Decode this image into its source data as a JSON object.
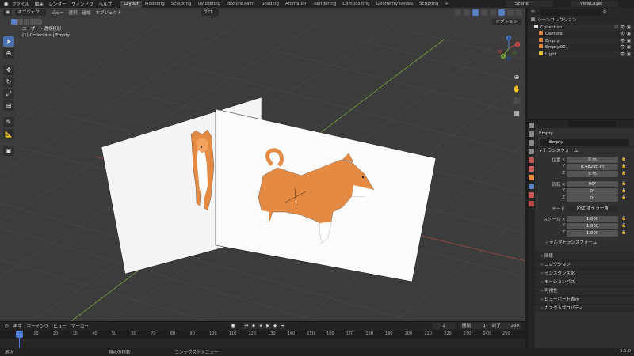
{
  "topbar": {
    "menu": [
      "ファイル",
      "編集",
      "レンダー",
      "ウィンドウ",
      "ヘルプ"
    ],
    "workspaces": [
      "Layout",
      "Modeling",
      "Sculpting",
      "UV Editing",
      "Texture Paint",
      "Shading",
      "Animation",
      "Rendering",
      "Compositing",
      "Geometry Nodes",
      "Scripting"
    ],
    "active_workspace": "Layout",
    "add_tab": "+",
    "scene": "Scene",
    "view_layer": "ViewLayer"
  },
  "viewport": {
    "mode": "オブジェク...",
    "menus": [
      "ビュー",
      "選択",
      "追加",
      "オブジェクト"
    ],
    "transform_orientation": "グロ...",
    "view_name": "ユーザー・透視投影",
    "view_context": "(1) Collection | Empty",
    "options_label": "オプション"
  },
  "gizmo": {
    "x": "X",
    "y": "Y",
    "z": "Z"
  },
  "timeline": {
    "menus": [
      "再生",
      "キーイング",
      "ビュー",
      "マーカー"
    ],
    "current_frame": "1",
    "start_label": "開始",
    "start": "1",
    "end_label": "終了",
    "end": "250",
    "ticks": [
      "1",
      "10",
      "20",
      "30",
      "40",
      "50",
      "60",
      "70",
      "80",
      "90",
      "100",
      "110",
      "120",
      "130",
      "140",
      "150",
      "160",
      "170",
      "180",
      "190",
      "200",
      "210",
      "220",
      "230",
      "240",
      "250"
    ]
  },
  "statusbar": {
    "select": "選択",
    "rotate": "視点の移動",
    "context_menu": "コンテクストメニュー",
    "version": "3.5.0"
  },
  "outliner": {
    "scene_collection": "シーンコレクション",
    "collection": "Collection",
    "items": [
      "Camera",
      "Empty",
      "Empty.001",
      "Light"
    ]
  },
  "properties": {
    "object_name": "Empty",
    "object_field": "Empty",
    "transform_section": "トランスフォーム",
    "location_label": "位置 X",
    "location": {
      "x": "0 m",
      "y": "0.48295 m",
      "z": "0 m"
    },
    "rotation_label": "回転 X",
    "rotation": {
      "x": "90°",
      "y": "0°",
      "z": "0°"
    },
    "mode_label": "モード",
    "mode": "XYZ オイラー角",
    "scale_label": "スケール X",
    "scale": {
      "x": "1.000",
      "y": "1.000",
      "z": "1.000"
    },
    "axis_y": "Y",
    "axis_z": "Z",
    "delta_transform": "デルタトランスフォーム",
    "panels": [
      "関係",
      "コレクション",
      "インスタンス化",
      "モーションパス",
      "可視性",
      "ビューポート表示",
      "カスタムプロパティ"
    ]
  },
  "colors": {
    "accent": "#4a7ad1",
    "dog_orange": "#e58a42",
    "x_axis": "#a04848",
    "y_axis": "#6e9a3a",
    "viewport_bg": "#3c3c3c"
  }
}
